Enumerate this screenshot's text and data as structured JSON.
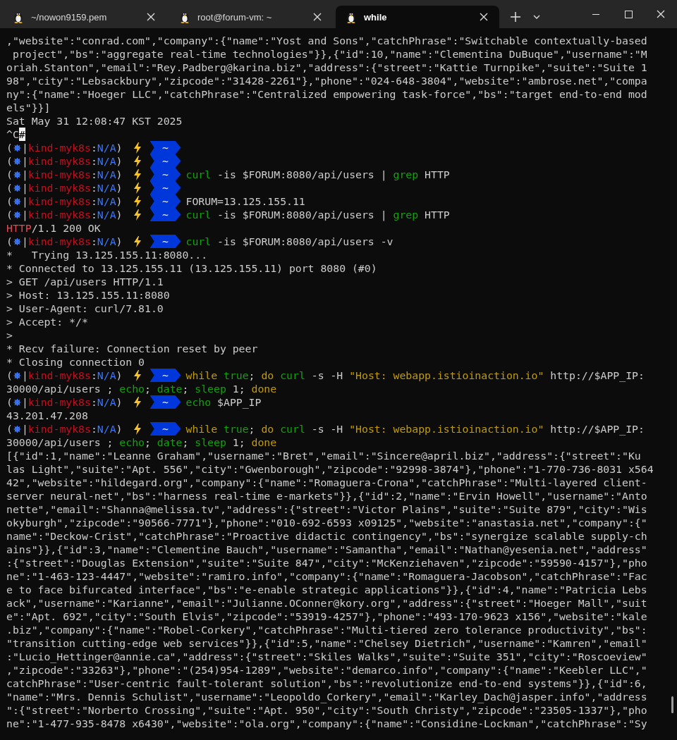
{
  "tabs": [
    {
      "title": "~/nowon9159.pem",
      "selected": false
    },
    {
      "title": "root@forum-vm: ~",
      "selected": false
    },
    {
      "title": "while",
      "selected": true
    }
  ],
  "terminal": {
    "lines": [
      {
        "kind": "output",
        "text": ",\"website\":\"conrad.com\",\"company\":{\"name\":\"Yost and Sons\",\"catchPhrase\":\"Switchable contextually-based"
      },
      {
        "kind": "output",
        "text": " project\",\"bs\":\"aggregate real-time technologies\"}},{\"id\":10,\"name\":\"Clementina DuBuque\",\"username\":\"M"
      },
      {
        "kind": "output",
        "text": "oriah.Stanton\",\"email\":\"Rey.Padberg@karina.biz\",\"address\":{\"street\":\"Kattie Turnpike\",\"suite\":\"Suite 1"
      },
      {
        "kind": "output",
        "text": "98\",\"city\":\"Lebsackbury\",\"zipcode\":\"31428-2261\"},\"phone\":\"024-648-3804\",\"website\":\"ambrose.net\",\"compa"
      },
      {
        "kind": "output",
        "text": "ny\":{\"name\":\"Hoeger LLC\",\"catchPhrase\":\"Centralized empowering task-force\",\"bs\":\"target end-to-end mod"
      },
      {
        "kind": "output",
        "text": "els\"}}]"
      },
      {
        "kind": "output",
        "text": "Sat May 31 12:08:47 KST 2025"
      },
      {
        "kind": "output",
        "segments": [
          {
            "text": "^C",
            "kind": "plain"
          },
          {
            "text": "#",
            "kind": "cursor"
          }
        ]
      },
      {
        "kind": "prompt",
        "open": "(",
        "context": [
          {
            "text": "|",
            "kind": "plain"
          },
          {
            "text": "kind-myk8s",
            "kind": "context"
          },
          {
            "text": ":",
            "kind": "plain"
          },
          {
            "text": "N/A",
            "kind": "namespace"
          },
          {
            "text": ")",
            "kind": "plain"
          }
        ],
        "dir": "~"
      },
      {
        "kind": "prompt",
        "open": "(",
        "context": [
          {
            "text": "|",
            "kind": "plain"
          },
          {
            "text": "kind-myk8s",
            "kind": "context"
          },
          {
            "text": ":",
            "kind": "plain"
          },
          {
            "text": "N/A",
            "kind": "namespace"
          },
          {
            "text": ")",
            "kind": "plain"
          }
        ],
        "dir": "~"
      },
      {
        "kind": "prompt",
        "open": "(",
        "context": [
          {
            "text": "|",
            "kind": "plain"
          },
          {
            "text": "kind-myk8s",
            "kind": "context"
          },
          {
            "text": ":",
            "kind": "plain"
          },
          {
            "text": "N/A",
            "kind": "namespace"
          },
          {
            "text": ")",
            "kind": "plain"
          }
        ],
        "dir": "~",
        "command": [
          {
            "text": "curl",
            "kind": "command"
          },
          {
            "text": " -is $FORUM:8080/api/users | ",
            "kind": "plain"
          },
          {
            "text": "grep",
            "kind": "command"
          },
          {
            "text": " HTTP",
            "kind": "plain"
          }
        ]
      },
      {
        "kind": "prompt",
        "open": "(",
        "context": [
          {
            "text": "|",
            "kind": "plain"
          },
          {
            "text": "kind-myk8s",
            "kind": "context"
          },
          {
            "text": ":",
            "kind": "plain"
          },
          {
            "text": "N/A",
            "kind": "namespace"
          },
          {
            "text": ")",
            "kind": "plain"
          }
        ],
        "dir": "~"
      },
      {
        "kind": "prompt",
        "open": "(",
        "context": [
          {
            "text": "|",
            "kind": "plain"
          },
          {
            "text": "kind-myk8s",
            "kind": "context"
          },
          {
            "text": ":",
            "kind": "plain"
          },
          {
            "text": "N/A",
            "kind": "namespace"
          },
          {
            "text": ")",
            "kind": "plain"
          }
        ],
        "dir": "~",
        "command": [
          {
            "text": "FORUM=13.125.155.11",
            "kind": "plain"
          }
        ]
      },
      {
        "kind": "prompt",
        "open": "(",
        "context": [
          {
            "text": "|",
            "kind": "plain"
          },
          {
            "text": "kind-myk8s",
            "kind": "context"
          },
          {
            "text": ":",
            "kind": "plain"
          },
          {
            "text": "N/A",
            "kind": "namespace"
          },
          {
            "text": ")",
            "kind": "plain"
          }
        ],
        "dir": "~",
        "command": [
          {
            "text": "curl",
            "kind": "command"
          },
          {
            "text": " -is $FORUM:8080/api/users | ",
            "kind": "plain"
          },
          {
            "text": "grep",
            "kind": "command"
          },
          {
            "text": " HTTP",
            "kind": "plain"
          }
        ]
      },
      {
        "kind": "output",
        "segments": [
          {
            "text": "HTTP",
            "kind": "error"
          },
          {
            "text": "/1.1 200 OK",
            "kind": "plain"
          }
        ]
      },
      {
        "kind": "prompt",
        "open": "(",
        "context": [
          {
            "text": "|",
            "kind": "plain"
          },
          {
            "text": "kind-myk8s",
            "kind": "context"
          },
          {
            "text": ":",
            "kind": "plain"
          },
          {
            "text": "N/A",
            "kind": "namespace"
          },
          {
            "text": ")",
            "kind": "plain"
          }
        ],
        "dir": "~",
        "command": [
          {
            "text": "curl",
            "kind": "command"
          },
          {
            "text": " -is $FORUM:8080/api/users -v",
            "kind": "plain"
          }
        ]
      },
      {
        "kind": "output",
        "text": "*   Trying 13.125.155.11:8080..."
      },
      {
        "kind": "output",
        "text": "* Connected to 13.125.155.11 (13.125.155.11) port 8080 (#0)"
      },
      {
        "kind": "output",
        "text": "> GET /api/users HTTP/1.1"
      },
      {
        "kind": "output",
        "text": "> Host: 13.125.155.11:8080"
      },
      {
        "kind": "output",
        "text": "> User-Agent: curl/7.81.0"
      },
      {
        "kind": "output",
        "text": "> Accept: */*"
      },
      {
        "kind": "output",
        "text": ">"
      },
      {
        "kind": "output",
        "text": "* Recv failure: Connection reset by peer"
      },
      {
        "kind": "output",
        "text": "* Closing connection 0"
      },
      {
        "kind": "prompt",
        "open": "(",
        "context": [
          {
            "text": "|",
            "kind": "plain"
          },
          {
            "text": "kind-myk8s",
            "kind": "context"
          },
          {
            "text": ":",
            "kind": "plain"
          },
          {
            "text": "N/A",
            "kind": "namespace"
          },
          {
            "text": ")",
            "kind": "plain"
          }
        ],
        "dir": "~",
        "command": [
          {
            "text": "while ",
            "kind": "keyword"
          },
          {
            "text": "true",
            "kind": "command"
          },
          {
            "text": "; ",
            "kind": "plain"
          },
          {
            "text": "do ",
            "kind": "keyword"
          },
          {
            "text": "curl",
            "kind": "command"
          },
          {
            "text": " -s -H ",
            "kind": "plain"
          },
          {
            "text": "\"Host: webapp.istioinaction.io\"",
            "kind": "string"
          },
          {
            "text": " http://$APP_IP:",
            "kind": "plain"
          }
        ]
      },
      {
        "kind": "output",
        "segments": [
          {
            "text": "30000/api/users ; ",
            "kind": "plain"
          },
          {
            "text": "echo",
            "kind": "command"
          },
          {
            "text": "; ",
            "kind": "plain"
          },
          {
            "text": "date",
            "kind": "command"
          },
          {
            "text": "; ",
            "kind": "plain"
          },
          {
            "text": "sleep",
            "kind": "command"
          },
          {
            "text": " 1; ",
            "kind": "plain"
          },
          {
            "text": "done",
            "kind": "keyword"
          }
        ]
      },
      {
        "kind": "prompt",
        "open": "(",
        "context": [
          {
            "text": "|",
            "kind": "plain"
          },
          {
            "text": "kind-myk8s",
            "kind": "context"
          },
          {
            "text": ":",
            "kind": "plain"
          },
          {
            "text": "N/A",
            "kind": "namespace"
          },
          {
            "text": ")",
            "kind": "plain"
          }
        ],
        "dir": "~",
        "command": [
          {
            "text": "echo",
            "kind": "command"
          },
          {
            "text": " $APP_IP",
            "kind": "plain"
          }
        ]
      },
      {
        "kind": "output",
        "text": "43.201.47.208"
      },
      {
        "kind": "prompt",
        "open": "(",
        "context": [
          {
            "text": "|",
            "kind": "plain"
          },
          {
            "text": "kind-myk8s",
            "kind": "context"
          },
          {
            "text": ":",
            "kind": "plain"
          },
          {
            "text": "N/A",
            "kind": "namespace"
          },
          {
            "text": ")",
            "kind": "plain"
          }
        ],
        "dir": "~",
        "command": [
          {
            "text": "while ",
            "kind": "keyword"
          },
          {
            "text": "true",
            "kind": "command"
          },
          {
            "text": "; ",
            "kind": "plain"
          },
          {
            "text": "do ",
            "kind": "keyword"
          },
          {
            "text": "curl",
            "kind": "command"
          },
          {
            "text": " -s -H ",
            "kind": "plain"
          },
          {
            "text": "\"Host: webapp.istioinaction.io\"",
            "kind": "string"
          },
          {
            "text": " http://$APP_IP:",
            "kind": "plain"
          }
        ]
      },
      {
        "kind": "output",
        "segments": [
          {
            "text": "30000/api/users ; ",
            "kind": "plain"
          },
          {
            "text": "echo",
            "kind": "command"
          },
          {
            "text": "; ",
            "kind": "plain"
          },
          {
            "text": "date",
            "kind": "command"
          },
          {
            "text": "; ",
            "kind": "plain"
          },
          {
            "text": "sleep",
            "kind": "command"
          },
          {
            "text": " 1; ",
            "kind": "plain"
          },
          {
            "text": "done",
            "kind": "keyword"
          }
        ]
      },
      {
        "kind": "output",
        "text": "[{\"id\":1,\"name\":\"Leanne Graham\",\"username\":\"Bret\",\"email\":\"Sincere@april.biz\",\"address\":{\"street\":\"Ku"
      },
      {
        "kind": "output",
        "text": "las Light\",\"suite\":\"Apt. 556\",\"city\":\"Gwenborough\",\"zipcode\":\"92998-3874\"},\"phone\":\"1-770-736-8031 x564"
      },
      {
        "kind": "output",
        "text": "42\",\"website\":\"hildegard.org\",\"company\":{\"name\":\"Romaguera-Crona\",\"catchPhrase\":\"Multi-layered client-"
      },
      {
        "kind": "output",
        "text": "server neural-net\",\"bs\":\"harness real-time e-markets\"}},{\"id\":2,\"name\":\"Ervin Howell\",\"username\":\"Anto"
      },
      {
        "kind": "output",
        "text": "nette\",\"email\":\"Shanna@melissa.tv\",\"address\":{\"street\":\"Victor Plains\",\"suite\":\"Suite 879\",\"city\":\"Wis"
      },
      {
        "kind": "output",
        "text": "okyburgh\",\"zipcode\":\"90566-7771\"},\"phone\":\"010-692-6593 x09125\",\"website\":\"anastasia.net\",\"company\":{\""
      },
      {
        "kind": "output",
        "text": "name\":\"Deckow-Crist\",\"catchPhrase\":\"Proactive didactic contingency\",\"bs\":\"synergize scalable supply-ch"
      },
      {
        "kind": "output",
        "text": "ains\"}},{\"id\":3,\"name\":\"Clementine Bauch\",\"username\":\"Samantha\",\"email\":\"Nathan@yesenia.net\",\"address\""
      },
      {
        "kind": "output",
        "text": ":{\"street\":\"Douglas Extension\",\"suite\":\"Suite 847\",\"city\":\"McKenziehaven\",\"zipcode\":\"59590-4157\"},\"pho"
      },
      {
        "kind": "output",
        "text": "ne\":\"1-463-123-4447\",\"website\":\"ramiro.info\",\"company\":{\"name\":\"Romaguera-Jacobson\",\"catchPhrase\":\"Fac"
      },
      {
        "kind": "output",
        "text": "e to face bifurcated interface\",\"bs\":\"e-enable strategic applications\"}},{\"id\":4,\"name\":\"Patricia Lebs"
      },
      {
        "kind": "output",
        "text": "ack\",\"username\":\"Karianne\",\"email\":\"Julianne.OConner@kory.org\",\"address\":{\"street\":\"Hoeger Mall\",\"suit"
      },
      {
        "kind": "output",
        "text": "e\":\"Apt. 692\",\"city\":\"South Elvis\",\"zipcode\":\"53919-4257\"},\"phone\":\"493-170-9623 x156\",\"website\":\"kale"
      },
      {
        "kind": "output",
        "text": ".biz\",\"company\":{\"name\":\"Robel-Corkery\",\"catchPhrase\":\"Multi-tiered zero tolerance productivity\",\"bs\":"
      },
      {
        "kind": "output",
        "text": "\"transition cutting-edge web services\"}},{\"id\":5,\"name\":\"Chelsey Dietrich\",\"username\":\"Kamren\",\"email\""
      },
      {
        "kind": "output",
        "text": ":\"Lucio_Hettinger@annie.ca\",\"address\":{\"street\":\"Skiles Walks\",\"suite\":\"Suite 351\",\"city\":\"Roscoeview\""
      },
      {
        "kind": "output",
        "text": ",\"zipcode\":\"33263\"},\"phone\":\"(254)954-1289\",\"website\":\"demarco.info\",\"company\":{\"name\":\"Keebler LLC\",\""
      },
      {
        "kind": "output",
        "text": "catchPhrase\":\"User-centric fault-tolerant solution\",\"bs\":\"revolutionize end-to-end systems\"}},{\"id\":6,"
      },
      {
        "kind": "output",
        "text": "\"name\":\"Mrs. Dennis Schulist\",\"username\":\"Leopoldo_Corkery\",\"email\":\"Karley_Dach@jasper.info\",\"address"
      },
      {
        "kind": "output",
        "text": "\":{\"street\":\"Norberto Crossing\",\"suite\":\"Apt. 950\",\"city\":\"South Christy\",\"zipcode\":\"23505-1337\"},\"pho"
      },
      {
        "kind": "output",
        "text": "ne\":\"1-477-935-8478 x6430\",\"website\":\"ola.org\",\"company\":{\"name\":\"Considine-Lockman\",\"catchPhrase\":\"Sy"
      }
    ]
  }
}
